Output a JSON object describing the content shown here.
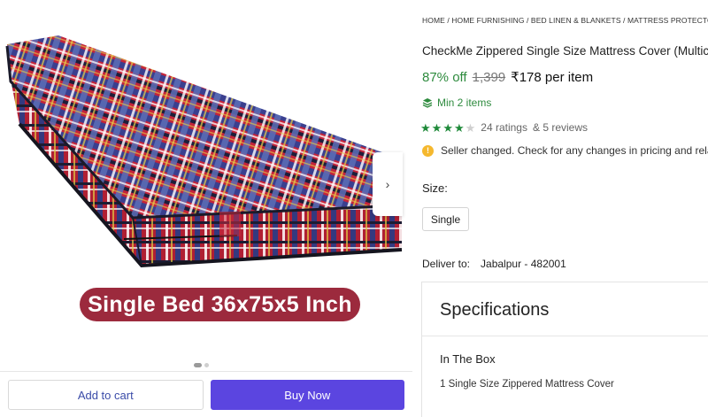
{
  "gallery": {
    "caption": "Single Bed 36x75x5 Inch",
    "next_glyph": "›",
    "dots_total": 2,
    "dots_active": 1
  },
  "actions": {
    "add_to_cart": "Add to cart",
    "buy_now": "Buy Now"
  },
  "breadcrumb": "HOME / HOME FURNISHING / BED LINEN & BLANKETS / MATTRESS PROTECTORS /",
  "product": {
    "title": "CheckMe Zippered Single Size Mattress Cover (Multic",
    "discount": "87% off",
    "mrp": "1,399",
    "price": "₹178 per item",
    "min_qty": "Min 2 items",
    "rating_stars": 4,
    "rating_max": 5,
    "ratings_text": "24 ratings",
    "reviews_text": "& 5 reviews",
    "notice": "Seller changed. Check for any changes in pricing and related"
  },
  "size": {
    "label": "Size:",
    "selected": "Single"
  },
  "delivery": {
    "label": "Deliver to:",
    "location": "Jabalpur - 482001"
  },
  "specifications": {
    "title": "Specifications",
    "key": "In The Box",
    "value": "1 Single Size Zippered Mattress Cover"
  },
  "colors": {
    "accent_green": "#2e8b3e",
    "buy_button": "#5b45e0",
    "caption_bg": "#9c2a3d",
    "warning": "#f5b82e"
  },
  "icons": {
    "next": "chevron-right-icon",
    "min": "stack-icon",
    "warning": "warning-icon",
    "star": "star-icon"
  }
}
